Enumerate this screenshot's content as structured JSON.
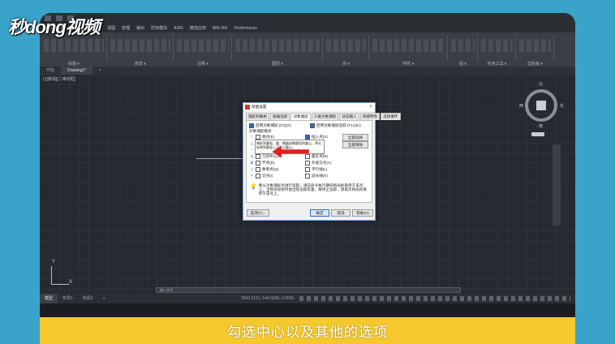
{
  "watermark": "秒dong视频",
  "caption": "勾选中心以及其他的选项",
  "menubar": [
    "默认",
    "插入",
    "注释",
    "参数化",
    "视图",
    "管理",
    "输出",
    "附加模块",
    "A360",
    "精选应用",
    "BIM 360",
    "Performance"
  ],
  "ribbon_labels": [
    "绘图 ▾",
    "修改 ▾",
    "注释 ▾",
    "图层 ▾",
    "块 ▾",
    "特性 ▾",
    "组 ▾",
    "实用工具 ▾",
    "剪贴板 ▾"
  ],
  "doc_tabs": {
    "start": "开始",
    "drawing": "Drawing1*",
    "add": "+"
  },
  "view_label": "[-][俯视][二维线框]",
  "viewcube": {
    "north": "北",
    "south": "南",
    "west": "西",
    "east": "东",
    "face": "上",
    "wcs": "WCS"
  },
  "ucs": {
    "x": "X",
    "y": "Y"
  },
  "command_placeholder": "键入命令",
  "layout_tabs": [
    "模型",
    "布局1",
    "布局2",
    "+"
  ],
  "coordinates": "3696.0121, 544.5056, 0.0000",
  "status_model": "模型",
  "status_scale": "1:1 / 100%",
  "dialog": {
    "title": "草图设置",
    "close": "×",
    "tabs": [
      "捕捉和栅格",
      "极轴追踪",
      "对象捕捉",
      "三维对象捕捉",
      "动态输入",
      "快捷特性",
      "选择循环"
    ],
    "active_tab": "对象捕捉",
    "enable_osnap": "启用对象捕捉 (F3)(O)",
    "enable_tracking": "启用对象捕捉追踪 (F11)(K)",
    "group_label": "对象捕捉模式",
    "left_modes": [
      {
        "mark": "□",
        "label": "端点(E)",
        "checked": false
      },
      {
        "mark": "△",
        "label": "中点(M)",
        "checked": true
      },
      {
        "mark": "○",
        "label": "圆心(C)",
        "checked": true
      },
      {
        "mark": "◎",
        "label": "几何中心(G)",
        "checked": false
      },
      {
        "mark": "⊠",
        "label": "节点(D)",
        "checked": false
      },
      {
        "mark": "◇",
        "label": "象限点(Q)",
        "checked": false
      },
      {
        "mark": "×",
        "label": "交点(I)",
        "checked": false
      }
    ],
    "right_modes": [
      {
        "mark": "",
        "label": "插入点(S)",
        "checked": true
      },
      {
        "mark": "",
        "label": "垂足(P)",
        "checked": false
      },
      {
        "mark": "",
        "label": "切点(N)",
        "checked": false
      },
      {
        "mark": "",
        "label": "最近点(R)",
        "checked": false
      },
      {
        "mark": "",
        "label": "外观交点(A)",
        "checked": false
      },
      {
        "mark": "",
        "label": "平行线(L)",
        "checked": false
      },
      {
        "mark": "",
        "label": "延长线(X)",
        "checked": false
      }
    ],
    "select_all": "全部选择",
    "clear_all": "全部清除",
    "tooltip": "捕捉到圆弧、圆、椭圆或椭圆弧的圆心。将光标移到圆弧上可显示圆心。",
    "hint": "要从对象捕捉点进行追踪，请在命令执行期间将光标悬停于该点上。当移动光标时会出现追踪矢量，要停止追踪，请再次将光标悬停于该点上。",
    "options_button": "选项(T)...",
    "ok": "确定",
    "cancel": "取消",
    "help": "帮助(H)"
  }
}
